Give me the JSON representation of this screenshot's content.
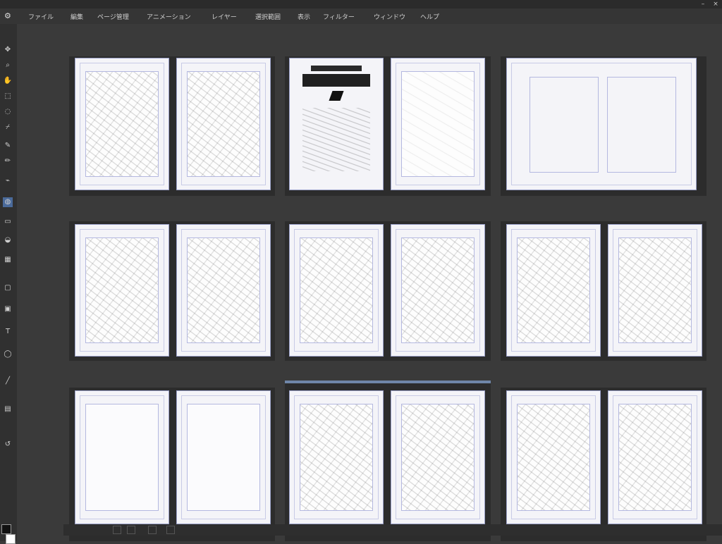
{
  "window": {},
  "menu": {
    "items": [
      "ファイル",
      "編集",
      "ページ管理",
      "アニメーション",
      "レイヤー",
      "選択範囲",
      "表示",
      "フィルター",
      "ウィンドウ",
      "ヘルプ"
    ]
  },
  "toolbar": {
    "icons": [
      "new-page-icon",
      "select-icon",
      "duplicate-icon",
      "delete-icon",
      "open-icon",
      "save-icon",
      "export-icon",
      "import-icon",
      "print-icon",
      "undo-icon",
      "redo-icon",
      "prev-icon",
      "next-icon",
      "zoom-in-icon",
      "zoom-out-icon",
      "fit-icon",
      "rotate-icon",
      "flip-icon",
      "settings-icon",
      "pen-icon",
      "ruler-icon",
      "grid-icon",
      "layer-icon",
      "text-icon",
      "page-icon"
    ]
  },
  "tab": {
    "label": ""
  },
  "left_tools": [
    "move",
    "zoom",
    "hand",
    "select",
    "lasso",
    "eyedropper",
    "pen",
    "pencil",
    "brush",
    "airbrush",
    "eraser",
    "fill",
    "gradient",
    "shape",
    "frame",
    "text",
    "balloon",
    "line",
    "ruler",
    "correct"
  ],
  "colors": {
    "foreground": "#111111",
    "background": "#ffffff",
    "accent": "#4a6a9a"
  },
  "pages": [
    {
      "style": "sketch",
      "num": ""
    },
    {
      "style": "sketch",
      "num": ""
    },
    {
      "style": "cover",
      "num": ""
    },
    {
      "style": "light",
      "num": ""
    },
    {
      "style": "blank",
      "num": ""
    },
    {
      "style": "blank",
      "num": ""
    },
    {
      "style": "sketch",
      "num": ""
    },
    {
      "style": "sketch",
      "num": ""
    },
    {
      "style": "sketch",
      "num": ""
    },
    {
      "style": "sketch",
      "num": ""
    },
    {
      "style": "sketch",
      "num": ""
    },
    {
      "style": "sketch",
      "num": ""
    },
    {
      "style": "blank",
      "num": ""
    },
    {
      "style": "blank",
      "num": ""
    },
    {
      "style": "sketch",
      "num": ""
    },
    {
      "style": "sketch",
      "num": ""
    },
    {
      "style": "sketch",
      "num": ""
    },
    {
      "style": "sketch",
      "num": ""
    }
  ],
  "status": {
    "zoom": ""
  }
}
